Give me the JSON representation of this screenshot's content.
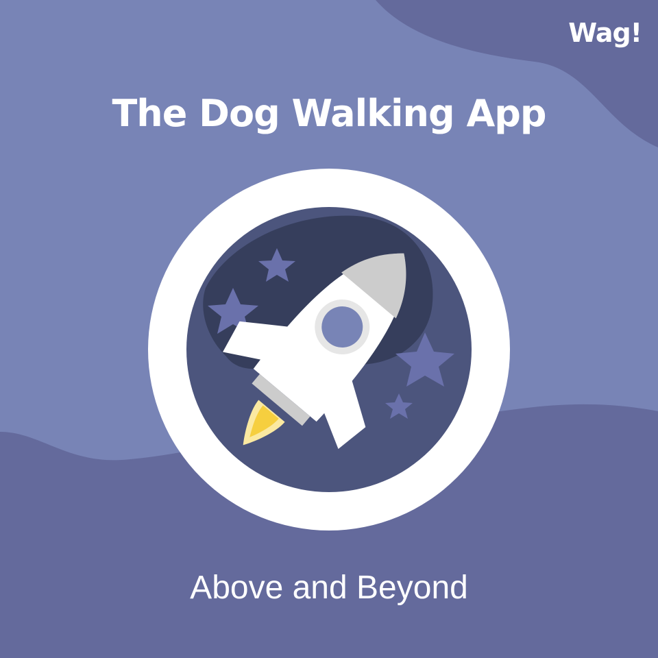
{
  "brand": {
    "logo_text": "Wag!"
  },
  "hero": {
    "title": "The Dog Walking App",
    "subtitle": "Above and Beyond",
    "badge_icon": "rocket-icon"
  },
  "colors": {
    "background": "#7884b6",
    "wave": "#646a9c",
    "badge_ring": "#ffffff",
    "badge_space": "#4c557d",
    "star": "#6a71ab",
    "rocket_body": "#ffffff",
    "rocket_nose": "#cccccc",
    "flame": "#f6cf3f"
  }
}
